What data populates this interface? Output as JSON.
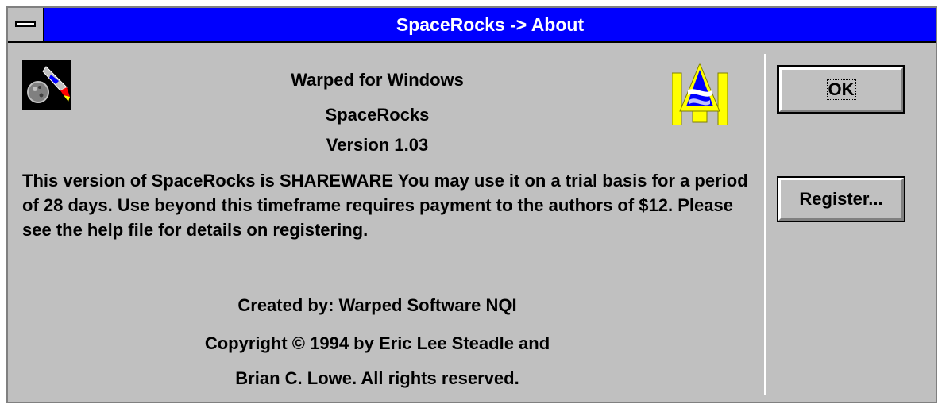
{
  "window": {
    "title": "SpaceRocks -> About"
  },
  "icons": {
    "system_menu": "system-menu-icon",
    "app": "spacerocks-asteroid-icon",
    "badge": "warped-software-logo-icon"
  },
  "about": {
    "product_line": "Warped for Windows",
    "app_name": "SpaceRocks",
    "version": "Version 1.03",
    "shareware_notice": "This version of SpaceRocks is SHAREWARE You may use it on a trial basis for a period of 28 days. Use beyond this timeframe requires payment to the authors of $12. Please see the help file for details on registering.",
    "created_by": "Created by: Warped Software NQI",
    "copyright_line1": "Copyright © 1994 by Eric Lee Steadle and",
    "copyright_line2": "Brian C. Lowe. All rights reserved."
  },
  "buttons": {
    "ok_label": "OK",
    "register_label": "Register..."
  },
  "colors": {
    "title_bar": "#0000fe",
    "face": "#c0c0c0",
    "logo_yellow": "#ffff00",
    "logo_blue": "#0000ff"
  }
}
